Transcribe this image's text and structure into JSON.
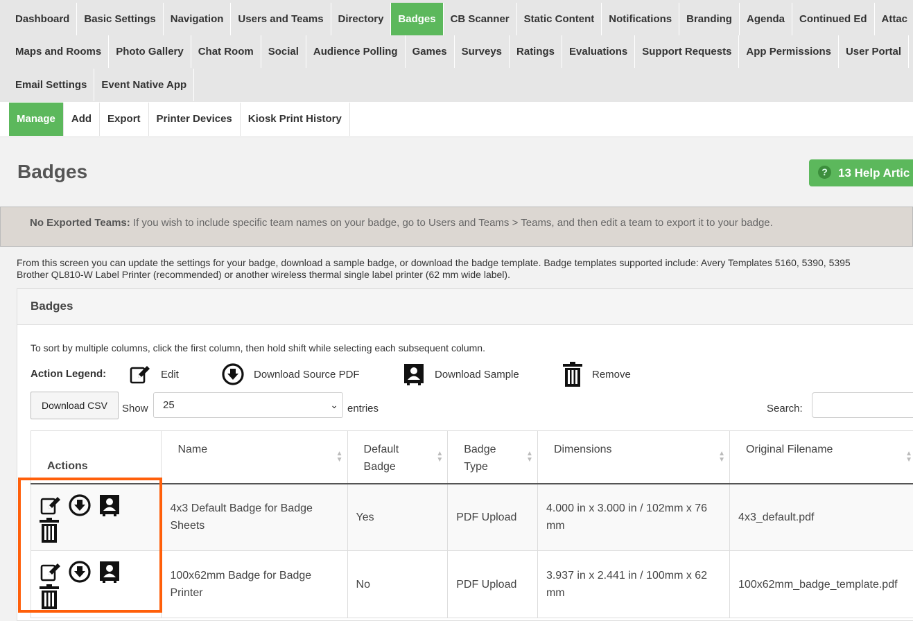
{
  "nav": {
    "row1": [
      "Dashboard",
      "Basic Settings",
      "Navigation",
      "Users and Teams",
      "Directory",
      "Badges",
      "CB Scanner",
      "Static Content",
      "Notifications",
      "Branding",
      "Agenda",
      "Continued Ed",
      "Attac"
    ],
    "row2": [
      "Maps and Rooms",
      "Photo Gallery",
      "Chat Room",
      "Social",
      "Audience Polling",
      "Games",
      "Surveys",
      "Ratings",
      "Evaluations",
      "Support Requests",
      "App Permissions",
      "User Portal"
    ],
    "row3": [
      "Email Settings",
      "Event Native App"
    ],
    "active": "Badges"
  },
  "subnav": {
    "items": [
      "Manage",
      "Add",
      "Export",
      "Printer Devices",
      "Kiosk Print History"
    ],
    "active": "Manage"
  },
  "page": {
    "title": "Badges",
    "help_label": "13 Help Artic"
  },
  "alert": {
    "strong": "No Exported Teams:",
    "text": " If you wish to include specific team names on your badge, go to Users and Teams > Teams, and then edit a team to export it to your badge."
  },
  "intro": {
    "line1": "From this screen you can update the settings for your badge, download a sample badge, or download the badge template.  Badge templates supported include:  Avery Templates 5160, 5390, 5395",
    "line2": "Brother QL810-W Label Printer (recommended) or another wireless thermal single label printer (62 mm wide label)."
  },
  "panel": {
    "title": "Badges",
    "sort_note": "To sort by multiple columns, click the first column, then hold shift while selecting each subsequent column.",
    "legend_label": "Action Legend:",
    "legend": {
      "edit": "Edit",
      "download_source": "Download Source PDF",
      "download_sample": "Download Sample",
      "remove": "Remove"
    },
    "download_csv": "Download CSV",
    "show_label": "Show",
    "entries_value": "25",
    "entries_label": "entries",
    "search_label": "Search:"
  },
  "table": {
    "headers": {
      "actions": "Actions",
      "name": "Name",
      "default_line1": "Default",
      "default_line2": "Badge",
      "type_line1": "Badge",
      "type_line2": "Type",
      "dimensions": "Dimensions",
      "filename": "Original Filename"
    },
    "rows": [
      {
        "name_line1": "4x3 Default Badge for Badge",
        "name_line2": "Sheets",
        "default": "Yes",
        "type": "PDF Upload",
        "dim_line1": "4.000 in x 3.000 in / 102mm x 76",
        "dim_line2": "mm",
        "filename": "4x3_default.pdf"
      },
      {
        "name_line1": "100x62mm Badge for Badge",
        "name_line2": "Printer",
        "default": "No",
        "type": "PDF Upload",
        "dim_line1": "3.937 in x 2.441 in / 100mm x 62",
        "dim_line2": "mm",
        "filename": "100x62mm_badge_template.pdf"
      }
    ]
  },
  "colors": {
    "accent_green": "#5cb85c",
    "highlight_orange": "#ff5f0a",
    "alert_bg": "#dcd7d2"
  }
}
